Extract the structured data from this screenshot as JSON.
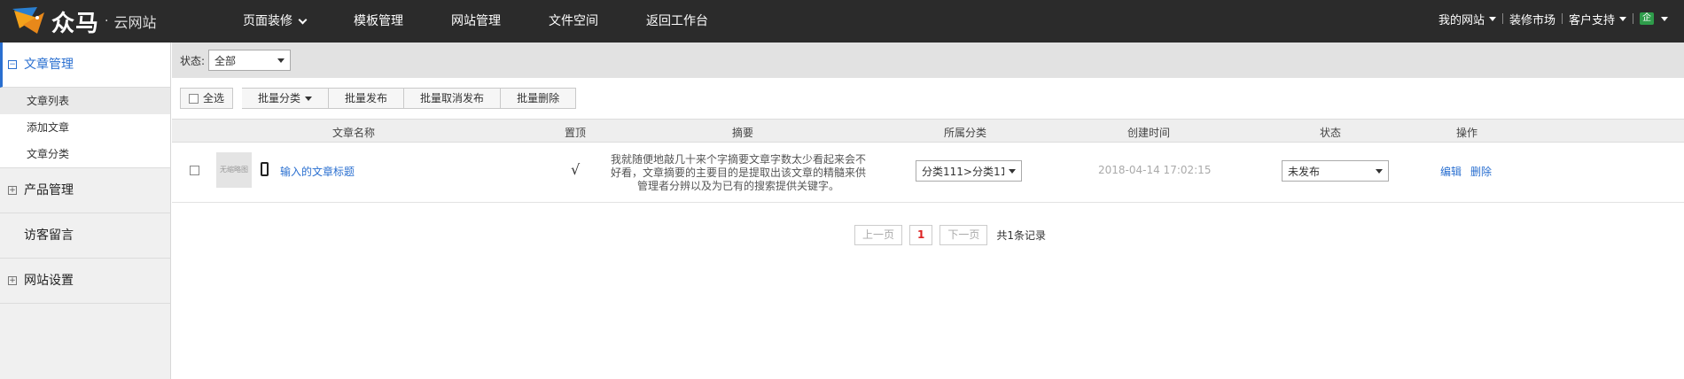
{
  "brand": {
    "name": "众马",
    "dot": "·",
    "sub": "云网站"
  },
  "topnav": [
    {
      "label": "页面装修",
      "has_dropdown": true
    },
    {
      "label": "模板管理"
    },
    {
      "label": "网站管理"
    },
    {
      "label": "文件空间"
    },
    {
      "label": "返回工作台"
    }
  ],
  "topright": {
    "my_site": "我的网站",
    "market": "装修市场",
    "support": "客户支持",
    "badge": "企"
  },
  "sidebar": {
    "groups": [
      {
        "label": "文章管理",
        "icon": "−",
        "active": true
      },
      {
        "label": "产品管理",
        "icon": "+"
      },
      {
        "label": "访客留言"
      },
      {
        "label": "网站设置",
        "icon": "+"
      }
    ],
    "sub_items": [
      "文章列表",
      "添加文章",
      "文章分类"
    ]
  },
  "filter": {
    "label": "状态:",
    "value": "全部"
  },
  "toolbar": {
    "check_all": "全选",
    "batch_category": "批量分类",
    "batch_publish": "批量发布",
    "batch_unpublish": "批量取消发布",
    "batch_delete": "批量删除"
  },
  "columns": {
    "title": "文章名称",
    "top": "置顶",
    "summary": "摘要",
    "category": "所属分类",
    "created": "创建时间",
    "status": "状态",
    "ops": "操作"
  },
  "rows": [
    {
      "thumb": "无缩略图",
      "title": "输入的文章标题",
      "top": "√",
      "summary": "我就随便地敲几十来个字摘要文章字数太少看起来会不好看，文章摘要的主要目的是提取出该文章的精髓来供管理者分辨以及为已有的搜索提供关键字。",
      "category": "分类111>分类111",
      "created": "2018-04-14 17:02:15",
      "status": "未发布",
      "edit": "编辑",
      "delete": "删除"
    }
  ],
  "pager": {
    "prev": "上一页",
    "current": "1",
    "next": "下一页",
    "total": "共1条记录"
  },
  "colors": {
    "topbar": "#2b2b2b",
    "link": "#2a6fd0",
    "current_page": "#dd2222",
    "badge": "#2e9c4a"
  }
}
